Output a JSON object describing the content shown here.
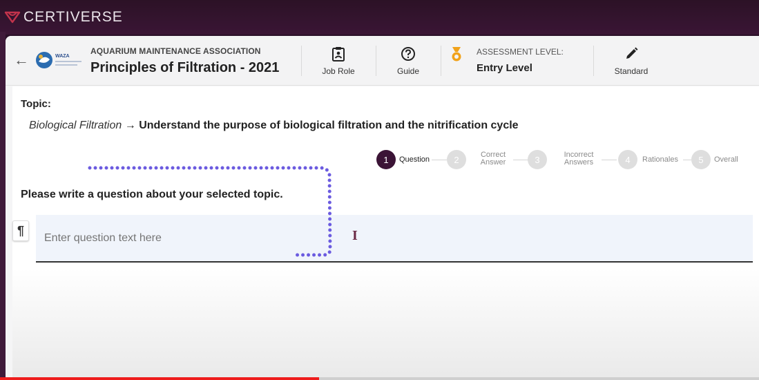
{
  "app": {
    "brand": "CERTIVERSE",
    "accent_color": "#3a1535"
  },
  "header": {
    "org_name": "AQUARIUM MAINTENANCE ASSOCIATION",
    "org_logo_text": "WAZA",
    "exam_title": "Principles of Filtration - 2021",
    "buttons": [
      {
        "label": "Job Role",
        "icon": "clipboard-badge-icon"
      },
      {
        "label": "Guide",
        "icon": "help-circle-icon"
      },
      {
        "label": "Standard",
        "icon": "pencil-icon"
      }
    ],
    "assessment": {
      "title": "ASSESSMENT LEVEL:",
      "value": "Entry Level",
      "icon": "medal-icon"
    }
  },
  "topic": {
    "label": "Topic:",
    "category": "Biological Filtration",
    "arrow": "→",
    "description": "Understand the purpose of biological filtration and the nitrification cycle"
  },
  "stepper": {
    "steps": [
      {
        "number": "1",
        "label": "Question",
        "active": true
      },
      {
        "number": "2",
        "label": "Correct Answer",
        "active": false
      },
      {
        "number": "3",
        "label": "Incorrect Answers",
        "active": false
      },
      {
        "number": "4",
        "label": "Rationales",
        "active": false
      },
      {
        "number": "5",
        "label": "Overall",
        "active": false
      }
    ]
  },
  "question": {
    "prompt": "Please write a question about your selected topic.",
    "placeholder": "Enter question text here",
    "value": "",
    "format_button": "¶"
  },
  "video": {
    "progress": 0.42
  }
}
